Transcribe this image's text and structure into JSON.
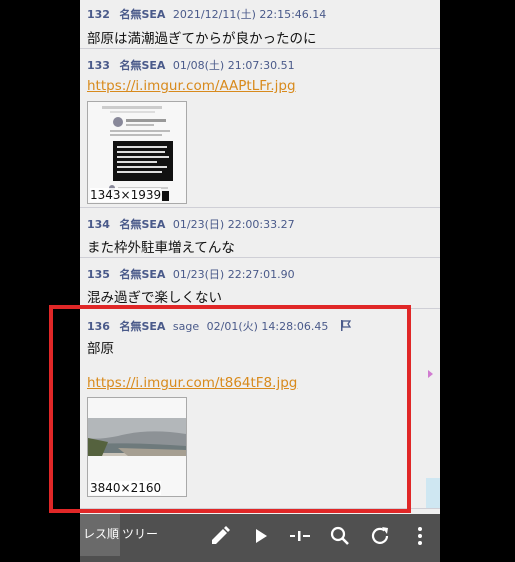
{
  "posts": [
    {
      "num": "132",
      "name": "名無SEA",
      "mail": "",
      "date": "2021/12/11(土) 22:15:46.14",
      "lines": [
        "部原は満潮過ぎてからが良かったのに"
      ],
      "links": [],
      "image_size": ""
    },
    {
      "num": "133",
      "name": "名無SEA",
      "mail": "",
      "date": "01/08(土) 21:07:30.51",
      "lines": [],
      "links": [
        "https://i.imgur.com/AAPtLFr.jpg"
      ],
      "image_size": "1343×1939"
    },
    {
      "num": "134",
      "name": "名無SEA",
      "mail": "",
      "date": "01/23(日) 22:00:33.27",
      "lines": [
        "また枠外駐車増えてんな"
      ],
      "links": [],
      "image_size": ""
    },
    {
      "num": "135",
      "name": "名無SEA",
      "mail": "",
      "date": "01/23(日) 22:27:01.90",
      "lines": [
        "混み過ぎで楽しくない"
      ],
      "links": [],
      "image_size": ""
    },
    {
      "num": "136",
      "name": "名無SEA",
      "mail": "sage",
      "date": "02/01(火) 14:28:06.45",
      "lines": [
        "部原"
      ],
      "links": [
        "https://i.imgur.com/t864tF8.jpg"
      ],
      "image_size": "3840×2160"
    }
  ],
  "toolbar": {
    "tab_res_order": "レス順",
    "tab_tree": "ツリー",
    "icons": [
      "pencil-icon",
      "play-icon",
      "slider-icon",
      "search-icon",
      "refresh-icon",
      "more-vert-icon"
    ]
  },
  "colors": {
    "accent": "#d88a1c",
    "header": "#4a5a8a",
    "highlight": "#e02727",
    "toolbar": "#505050"
  }
}
